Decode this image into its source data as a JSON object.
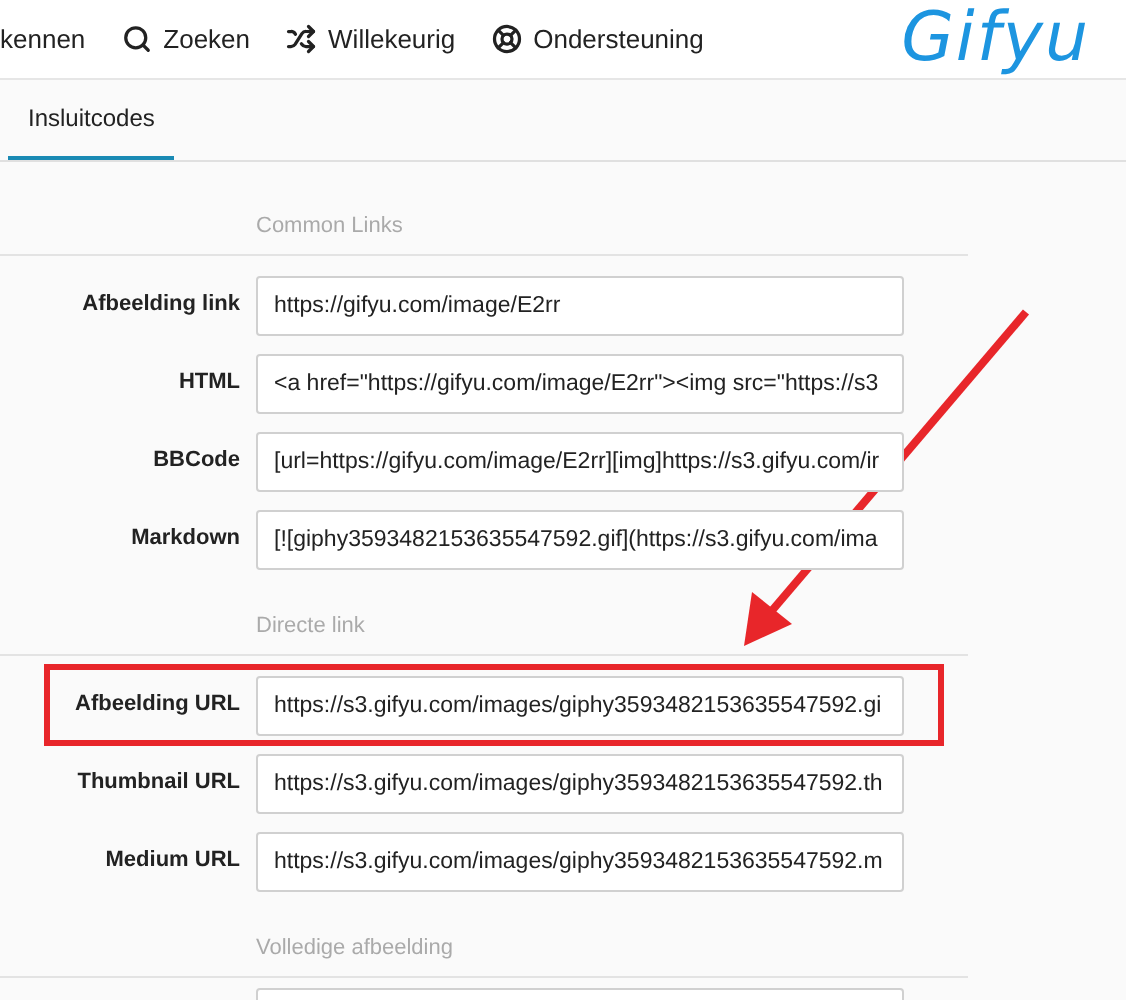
{
  "nav": [
    {
      "label": "kennen"
    },
    {
      "label": "Zoeken"
    },
    {
      "label": "Willekeurig"
    },
    {
      "label": "Ondersteuning"
    }
  ],
  "logo": "Gifyu",
  "tabs": [
    {
      "label": "Insluitcodes",
      "selected": true
    }
  ],
  "sections": [
    {
      "heading": "Common Links",
      "rows": [
        {
          "label": "Afbeelding link",
          "value": "https://gifyu.com/image/E2rr",
          "highlighted": false
        },
        {
          "label": "HTML",
          "value": "<a href=\"https://gifyu.com/image/E2rr\"><img src=\"https://s3",
          "highlighted": false
        },
        {
          "label": "BBCode",
          "value": "[url=https://gifyu.com/image/E2rr][img]https://s3.gifyu.com/ir",
          "highlighted": false
        },
        {
          "label": "Markdown",
          "value": "[![giphy3593482153635547592.gif](https://s3.gifyu.com/ima",
          "highlighted": false
        }
      ]
    },
    {
      "heading": "Directe link",
      "rows": [
        {
          "label": "Afbeelding URL",
          "value": "https://s3.gifyu.com/images/giphy3593482153635547592.gi",
          "highlighted": true
        },
        {
          "label": "Thumbnail URL",
          "value": "https://s3.gifyu.com/images/giphy3593482153635547592.th",
          "highlighted": false
        },
        {
          "label": "Medium URL",
          "value": "https://s3.gifyu.com/images/giphy3593482153635547592.m",
          "highlighted": false
        }
      ]
    },
    {
      "heading": "Volledige afbeelding"
    }
  ]
}
